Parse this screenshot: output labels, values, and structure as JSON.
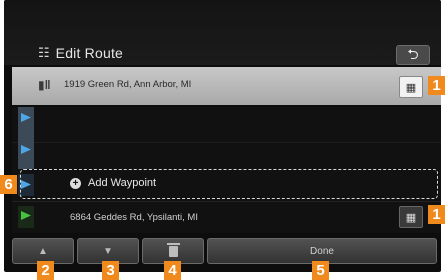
{
  "header": {
    "title": "Edit Route",
    "title_icon": "edit-route-icon",
    "back_glyph": "⮌"
  },
  "route": {
    "start": {
      "address": "1919 Green Rd, Ann Arbor, MI",
      "lane_glyph": "▮‖"
    },
    "add_waypoint": {
      "label": "Add Waypoint",
      "plus": "+"
    },
    "destination": {
      "address": "6864 Geddes Rd, Ypsilanti, MI"
    }
  },
  "buttons": {
    "up": "▲",
    "down": "▼",
    "delete_icon": "trash-icon",
    "done": "Done",
    "map_glyph": "▦"
  },
  "callouts": [
    "1",
    "1",
    "6",
    "2",
    "3",
    "4",
    "5"
  ],
  "colors": {
    "callout": "#f08a1c",
    "start_flag": "#4ea6e6",
    "destination_flag": "#45c23f",
    "highlight_row": "#c8c8c8"
  }
}
